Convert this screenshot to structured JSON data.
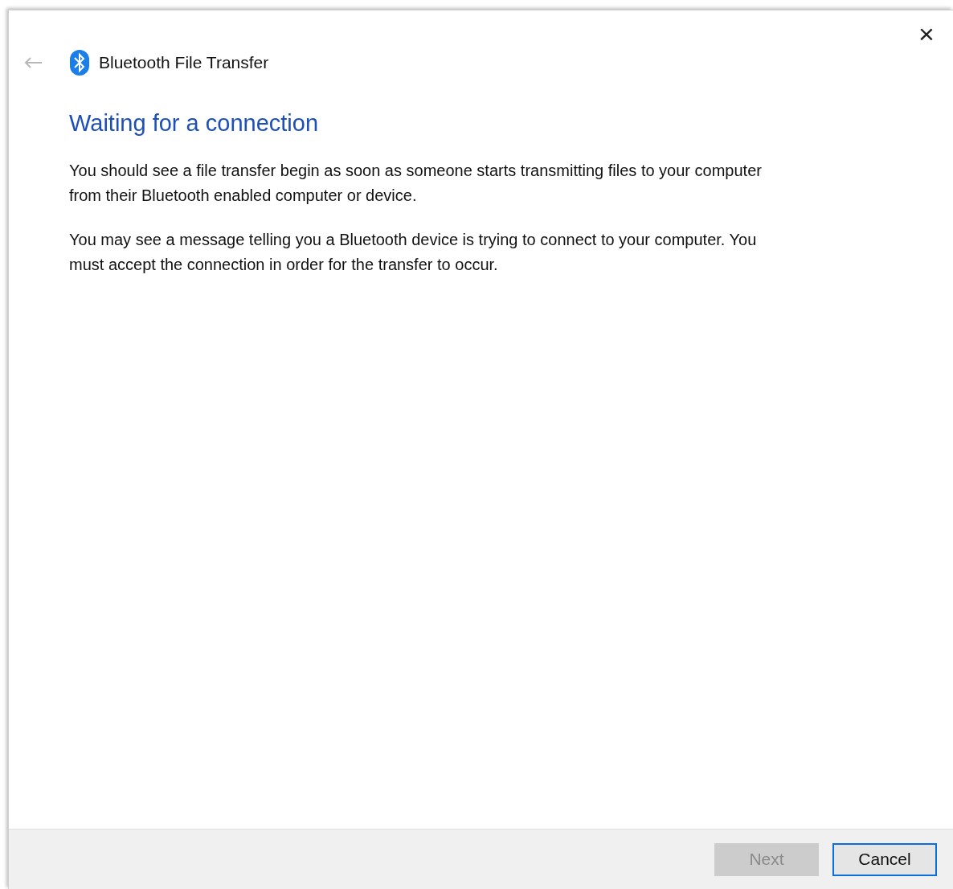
{
  "window": {
    "close": "×"
  },
  "back": {
    "disabled": true
  },
  "header": {
    "title": "Bluetooth File Transfer"
  },
  "heading": "Waiting for a connection",
  "paragraphs": [
    "You should see a file transfer begin as soon as someone starts transmitting files to your computer from their Bluetooth enabled computer or device.",
    "You may see a message telling you a Bluetooth device is trying to connect to your computer. You must accept the connection in order for the transfer to occur."
  ],
  "buttons": [
    {
      "label": "Next",
      "disabled": true,
      "default": false
    },
    {
      "label": "Cancel",
      "disabled": false,
      "default": true
    }
  ]
}
